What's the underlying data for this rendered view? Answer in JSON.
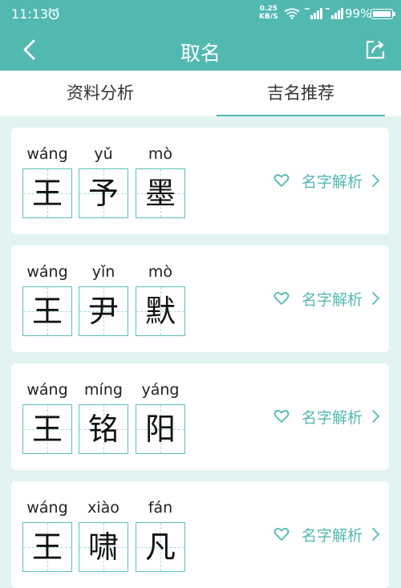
{
  "status_bar": {
    "time": "11:13",
    "net_speed_value": "0.25",
    "net_speed_unit": "KB/S",
    "battery": "99%"
  },
  "header": {
    "title": "取名",
    "back_icon": "chevron-left-icon",
    "share_icon": "share-icon"
  },
  "tabs": [
    {
      "label": "资料分析",
      "active": false
    },
    {
      "label": "吉名推荐",
      "active": true
    }
  ],
  "names": [
    {
      "pinyin": [
        "wáng",
        "yǔ",
        "mò"
      ],
      "chars": [
        "王",
        "予",
        "墨"
      ],
      "action": "名字解析"
    },
    {
      "pinyin": [
        "wáng",
        "yǐn",
        "mò"
      ],
      "chars": [
        "王",
        "尹",
        "默"
      ],
      "action": "名字解析"
    },
    {
      "pinyin": [
        "wáng",
        "míng",
        "yáng"
      ],
      "chars": [
        "王",
        "铭",
        "阳"
      ],
      "action": "名字解析"
    },
    {
      "pinyin": [
        "wáng",
        "xiào",
        "fán"
      ],
      "chars": [
        "王",
        "啸",
        "凡"
      ],
      "action": "名字解析"
    }
  ],
  "colors": {
    "accent": "#52b9b1",
    "page_bg": "#e3f3f1"
  }
}
